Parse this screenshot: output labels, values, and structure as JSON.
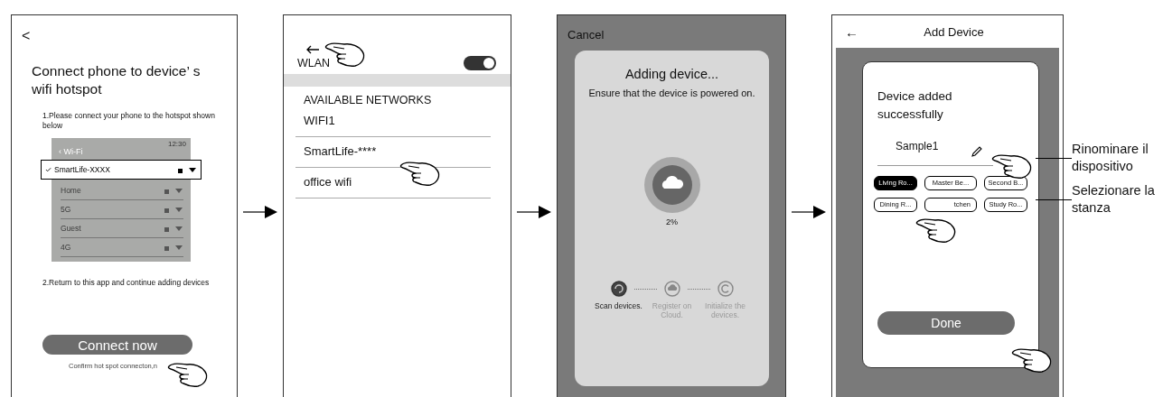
{
  "hotspot_screen": {
    "back": "<",
    "title": "Connect phone to device’ s wifi hotspot",
    "step_1": "1.Please connect your phone to the hotspot shown below",
    "inset": {
      "time": "12:30",
      "back_label": "‹ Wi-Fi",
      "networks": [
        {
          "name": "SmartLife-XXXX",
          "selected": true
        },
        {
          "name": "Home",
          "selected": false
        },
        {
          "name": "5G",
          "selected": false
        },
        {
          "name": "Guest",
          "selected": false
        },
        {
          "name": "4G",
          "selected": false
        }
      ]
    },
    "step_2": "2.Return to this app and continue adding devices",
    "button": "Connect now",
    "note": "Confirm hot spot connecton,n"
  },
  "wlan_screen": {
    "title": "WLAN",
    "toggle_on": true,
    "section": "AVAILABLE NETWORKS",
    "networks": [
      "WIFI1",
      "SmartLife-****",
      "office wifi"
    ]
  },
  "progress_screen": {
    "cancel": "Cancel",
    "title": "Adding device...",
    "subtitle": "Ensure that the device is powered on.",
    "percent": "2%",
    "steps": [
      {
        "label": "Scan devices.",
        "active": true
      },
      {
        "label": "Register on Cloud.",
        "active": false
      },
      {
        "label": "Initialize the devices.",
        "active": false
      }
    ]
  },
  "success_screen": {
    "back": "←",
    "title": "Add Device",
    "message": "Device added successfully",
    "device_name": "Sample1",
    "rooms": [
      {
        "label": "Living Ro...",
        "selected": true
      },
      {
        "label": "Master Be...",
        "selected": false
      },
      {
        "label": "Second B...",
        "selected": false
      },
      {
        "label": "Dining R...",
        "selected": false
      },
      {
        "label": "tchen",
        "selected": false
      },
      {
        "label": "Study Ro...",
        "selected": false
      }
    ],
    "button": "Done"
  },
  "callouts": [
    "Rinominare il dispositivo",
    "Selezionare la stanza"
  ]
}
